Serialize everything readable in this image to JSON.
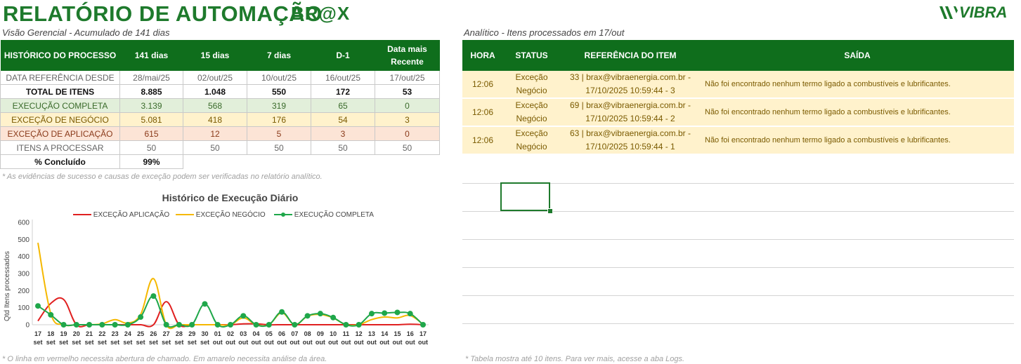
{
  "header": {
    "title": "RELATÓRIO DE AUTOMAÇÃO",
    "brax_logo": "BR@X",
    "vibra_logo": "VIBRA",
    "left_subtitle": "Visão Gerencial - Acumulado de 141 dias",
    "right_subtitle": "Analítico - Itens processados em 17/out"
  },
  "summary": {
    "columns": [
      "HISTÓRICO DO PROCESSO",
      "141 dias",
      "15 dias",
      "7 dias",
      "D-1",
      "Data mais Recente"
    ],
    "rows": [
      [
        "DATA REFERÊNCIA DESDE",
        "28/mai/25",
        "02/out/25",
        "10/out/25",
        "16/out/25",
        "17/out/25"
      ],
      [
        "TOTAL DE ITENS",
        "8.885",
        "1.048",
        "550",
        "172",
        "53"
      ],
      [
        "EXECUÇÃO COMPLETA",
        "3.139",
        "568",
        "319",
        "65",
        "0"
      ],
      [
        "EXCEÇÃO DE NEGÓCIO",
        "5.081",
        "418",
        "176",
        "54",
        "3"
      ],
      [
        "EXCEÇÃO DE APLICAÇÃO",
        "615",
        "12",
        "5",
        "3",
        "0"
      ],
      [
        "ITENS A PROCESSAR",
        "50",
        "50",
        "50",
        "50",
        "50"
      ]
    ],
    "pct_label": "% Concluído",
    "pct_value": "99%",
    "note": "* As evidências de sucesso e causas de exceção podem ser verificadas no relatório analítico."
  },
  "analytic": {
    "columns": [
      "HORA",
      "STATUS",
      "REFERÊNCIA DO ITEM",
      "SAÍDA"
    ],
    "rows": [
      {
        "hora": "12:06",
        "status_1": "Exceção",
        "status_2": "Negócio",
        "ref_1": "33 | brax@vibraenergia.com.br -",
        "ref_2": "17/10/2025 10:59:44 - 3",
        "saida": "Não foi encontrado nenhum termo ligado a combustíveis e lubrificantes."
      },
      {
        "hora": "12:06",
        "status_1": "Exceção",
        "status_2": "Negócio",
        "ref_1": "69 | brax@vibraenergia.com.br -",
        "ref_2": "17/10/2025 10:59:44 - 2",
        "saida": "Não foi encontrado nenhum termo ligado a combustíveis e lubrificantes."
      },
      {
        "hora": "12:06",
        "status_1": "Exceção",
        "status_2": "Negócio",
        "ref_1": "63 | brax@vibraenergia.com.br -",
        "ref_2": "17/10/2025 10:59:44 - 1",
        "saida": "Não foi encontrado nenhum termo ligado a combustíveis e lubrificantes."
      }
    ],
    "note": "* Tabela mostra até 10 itens. Para ver mais, acesse a aba Logs."
  },
  "chart_note": "* O linha em vermelho necessita abertura de chamado. Em amarelo necessita análise da área.",
  "colors": {
    "green": "#1e7a2c",
    "header_green": "#0f6e1c",
    "red": "#e02020",
    "yellow": "#f5b800",
    "completa": "#1fa74a"
  },
  "chart_data": {
    "type": "line",
    "title": "Histórico de Execução Diário",
    "ylabel": "Qtd Itens processados",
    "xlabel": "",
    "ylim": [
      0,
      600
    ],
    "yticks": [
      "0",
      "100",
      "200",
      "300",
      "400",
      "500",
      "600"
    ],
    "legend_position": "top",
    "categories": [
      "17 set",
      "18 set",
      "19 set",
      "20 set",
      "21 set",
      "22 set",
      "23 set",
      "24 set",
      "25 set",
      "26 set",
      "27 set",
      "28 set",
      "29 set",
      "30 set",
      "01 out",
      "02 out",
      "03 out",
      "04 out",
      "05 out",
      "06 out",
      "07 out",
      "08 out",
      "09 out",
      "10 out",
      "11 out",
      "12 out",
      "13 out",
      "14 out",
      "15 out",
      "16 out",
      "17 out"
    ],
    "series": [
      {
        "name": "EXCEÇÃO APLICAÇÃO",
        "color": "#e02020",
        "markers": false,
        "values": [
          22,
          125,
          148,
          0,
          0,
          0,
          0,
          0,
          0,
          0,
          135,
          0,
          0,
          0,
          0,
          0,
          5,
          5,
          0,
          0,
          0,
          0,
          0,
          0,
          0,
          0,
          0,
          0,
          0,
          3,
          0
        ]
      },
      {
        "name": "EXCEÇÃO NEGÓCIO",
        "color": "#f5b800",
        "markers": false,
        "values": [
          480,
          65,
          0,
          0,
          0,
          5,
          30,
          10,
          60,
          270,
          0,
          0,
          0,
          0,
          0,
          0,
          40,
          0,
          0,
          70,
          0,
          50,
          60,
          40,
          0,
          0,
          30,
          45,
          40,
          54,
          3
        ]
      },
      {
        "name": "EXECUÇÃO COMPLETA",
        "color": "#1fa74a",
        "markers": true,
        "values": [
          110,
          58,
          0,
          0,
          0,
          0,
          0,
          0,
          45,
          168,
          0,
          0,
          0,
          122,
          0,
          0,
          52,
          0,
          0,
          75,
          0,
          52,
          65,
          42,
          0,
          0,
          65,
          68,
          72,
          65,
          0
        ]
      }
    ]
  }
}
